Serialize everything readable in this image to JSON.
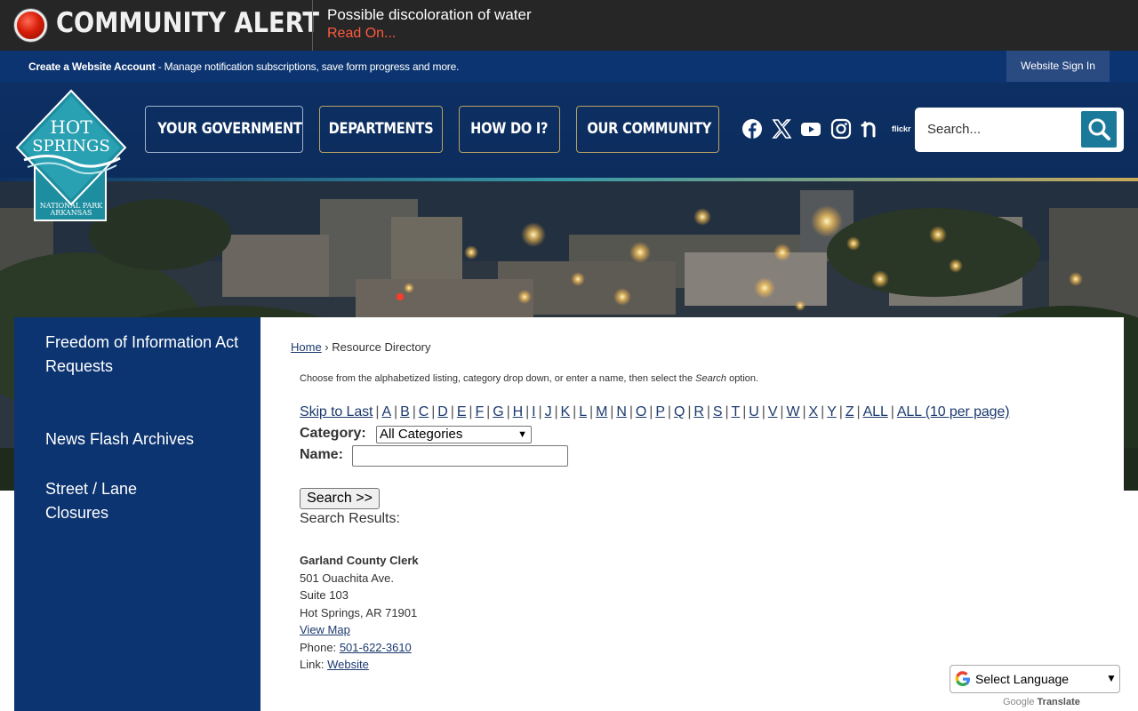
{
  "alert": {
    "title": "COMMUNITY ALERT",
    "message": "Possible discoloration of water",
    "link": "Read On..."
  },
  "account_strip": {
    "create_label": "Create a Website Account",
    "description": " - Manage notification subscriptions, save form progress and more.",
    "signin_label": "Website Sign In"
  },
  "logo": {
    "line1": "HOT",
    "line2": "SPRINGS",
    "line3": "NATIONAL PARK",
    "line4": "ARKANSAS"
  },
  "nav": [
    {
      "label": "YOUR GOVERNMENT"
    },
    {
      "label": "DEPARTMENTS"
    },
    {
      "label": "HOW DO I?"
    },
    {
      "label": "OUR COMMUNITY"
    }
  ],
  "social": {
    "icons": [
      "facebook-icon",
      "x-icon",
      "youtube-icon",
      "instagram-icon",
      "nextdoor-icon"
    ],
    "flickr_label": "flickr"
  },
  "search": {
    "placeholder": "Search..."
  },
  "sidebar": {
    "items": [
      {
        "label": "Freedom of Information Act Requests"
      },
      {
        "label": "News Flash Archives"
      },
      {
        "label": "Street / Lane Closures"
      }
    ]
  },
  "breadcrumb": {
    "home": "Home",
    "separator": " › ",
    "current": "Resource Directory"
  },
  "intro": {
    "before": "Choose from the alphabetized listing, category drop down, or enter a name, then select the ",
    "emphasis": "Search",
    "after": " option."
  },
  "alpha_links": [
    "Skip to Last",
    "A",
    "B",
    "C",
    "D",
    "E",
    "F",
    "G",
    "H",
    "I",
    "J",
    "K",
    "L",
    "M",
    "N",
    "O",
    "P",
    "Q",
    "R",
    "S",
    "T",
    "U",
    "V",
    "W",
    "X",
    "Y",
    "Z",
    "ALL",
    "ALL (10 per page)"
  ],
  "form": {
    "category_label": "Category:",
    "category_value": "All Categories",
    "name_label": "Name:",
    "name_value": "",
    "search_button": "Search >>"
  },
  "results": {
    "heading": "Search Results:",
    "items": [
      {
        "name": "Garland County Clerk",
        "address1": "501 Ouachita Ave.",
        "address2": "Suite 103",
        "city": "Hot Springs, AR 71901",
        "map_link": "View Map",
        "phone_label": "Phone: ",
        "phone": "501-622-3610",
        "link_label": "Link: ",
        "link": "Website"
      }
    ]
  },
  "translate": {
    "label": "Select Language",
    "powered_by": "Google",
    "translate_word": "Translate"
  },
  "colors": {
    "navy": "#0c3470",
    "alert_bg": "#262626",
    "alert_link": "#ff5a3c",
    "search_btn": "#1b7a99",
    "link": "#1c3a6e"
  }
}
